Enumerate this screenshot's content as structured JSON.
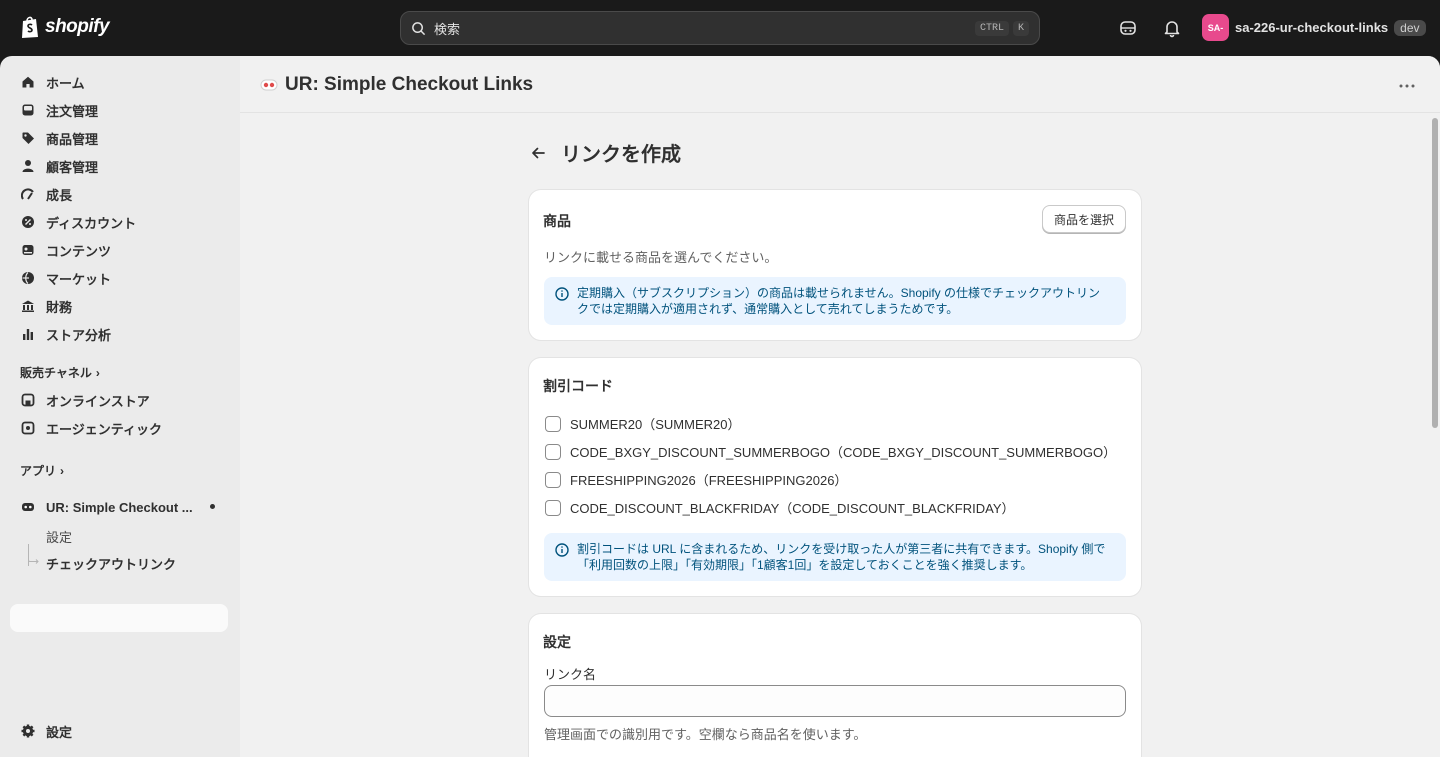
{
  "topbar": {
    "logo_text": "shopify",
    "search_placeholder": "検索",
    "shortcut_key1": "CTRL",
    "shortcut_key2": "K",
    "store_avatar_text": "SA-",
    "store_name": "sa-226-ur-checkout-links",
    "env_badge": "dev",
    "icons": [
      "shop-assistant-icon",
      "bell-icon"
    ]
  },
  "sidebar": {
    "items": [
      {
        "label": "ホーム",
        "icon": "home-icon"
      },
      {
        "label": "注文管理",
        "icon": "inbox-icon"
      },
      {
        "label": "商品管理",
        "icon": "tag-icon"
      },
      {
        "label": "顧客管理",
        "icon": "person-icon"
      },
      {
        "label": "成長",
        "icon": "growth-icon"
      },
      {
        "label": "ディスカウント",
        "icon": "discount-icon"
      },
      {
        "label": "コンテンツ",
        "icon": "content-icon"
      },
      {
        "label": "マーケット",
        "icon": "globe-icon"
      },
      {
        "label": "財務",
        "icon": "bank-icon"
      },
      {
        "label": "ストア分析",
        "icon": "chart-icon"
      }
    ],
    "sales_channels_heading": "販売チャネル",
    "channels": [
      {
        "label": "オンラインストア",
        "icon": "store-icon"
      },
      {
        "label": "エージェンティック",
        "icon": "agentic-icon"
      }
    ],
    "apps_heading": "アプリ",
    "app_name": "UR: Simple Checkout ...",
    "app_sub_items": [
      "設定",
      "チェックアウトリンク"
    ],
    "settings_label": "設定"
  },
  "app_header": {
    "title": "UR: Simple Checkout Links"
  },
  "page": {
    "title": "リンクを作成"
  },
  "product_card": {
    "title": "商品",
    "select_button": "商品を選択",
    "description": "リンクに載せる商品を選んでください。",
    "banner_line1": "定期購入（サブスクリプション）の商品は載せられません。Shopify の仕様でチェックアウトリン",
    "banner_line2": "クでは定期購入が適用されず、通常購入として売れてしまうためです。"
  },
  "discount_card": {
    "title": "割引コード",
    "codes": [
      "SUMMER20（SUMMER20）",
      "CODE_BXGY_DISCOUNT_SUMMERBOGO（CODE_BXGY_DISCOUNT_SUMMERBOGO）",
      "FREESHIPPING2026（FREESHIPPING2026）",
      "CODE_DISCOUNT_BLACKFRIDAY（CODE_DISCOUNT_BLACKFRIDAY）"
    ],
    "banner_line1": "割引コードは URL に含まれるため、リンクを受け取った人が第三者に共有できます。Shopify 側で",
    "banner_line2": "「利用回数の上限」「有効期限」「1顧客1回」を設定しておくことを強く推奨します。"
  },
  "settings_card": {
    "title": "設定",
    "link_name_label": "リンク名",
    "link_name_value": "",
    "link_name_help": "管理画面での識別用です。空欄なら商品名を使います。"
  }
}
